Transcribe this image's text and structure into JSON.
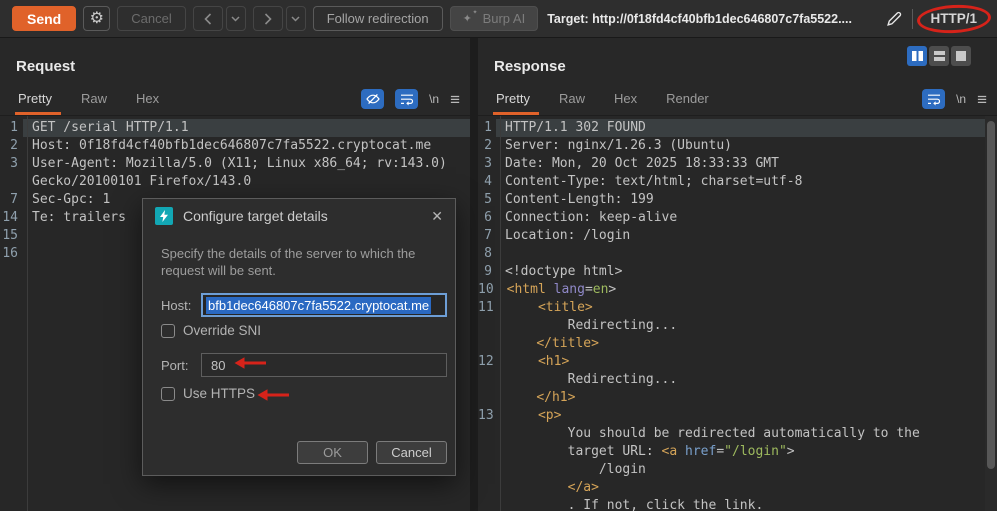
{
  "colors": {
    "accent_orange": "#e0622a",
    "accent_blue": "#2d6cc0",
    "annotation_red": "#d6231a",
    "syntax_tag": "#d5a458",
    "syntax_attribute": "#9089c9",
    "syntax_value": "#9eba5e"
  },
  "toolbar": {
    "send_label": "Send",
    "cancel_label": "Cancel",
    "follow_redirection_label": "Follow redirection",
    "burp_ai_label": "Burp AI",
    "target_text": "Target: http://0f18fd4cf40bfb1dec646807c7fa5522....",
    "http_version": "HTTP/1"
  },
  "request_panel": {
    "title": "Request",
    "tabs": [
      "Pretty",
      "Raw",
      "Hex"
    ],
    "newline_label": "\\n",
    "lines": [
      {
        "n": "1",
        "hl": true,
        "segs": [
          {
            "t": "GET /serial HTTP/1.1"
          }
        ]
      },
      {
        "n": "2",
        "segs": [
          {
            "t": "Host: 0f18fd4cf40bfb1dec646807c7fa5522.cryptocat.me"
          }
        ]
      },
      {
        "n": "3",
        "segs": [
          {
            "t": "User-Agent: Mozilla/5.0 (X11; Linux x86_64; rv:143.0)"
          }
        ]
      },
      {
        "n": "",
        "segs": [
          {
            "t": "Gecko/20100101 Firefox/143.0"
          }
        ]
      },
      {
        "n": "7",
        "segs": [
          {
            "t": "Sec-Gpc: 1"
          }
        ]
      },
      {
        "n": "14",
        "segs": [
          {
            "t": "Te: trailers"
          }
        ]
      },
      {
        "n": "15",
        "segs": []
      },
      {
        "n": "16",
        "segs": []
      }
    ]
  },
  "response_panel": {
    "title": "Response",
    "tabs": [
      "Pretty",
      "Raw",
      "Hex",
      "Render"
    ],
    "newline_label": "\\n",
    "lines": [
      {
        "n": "1",
        "hl": true,
        "segs": [
          {
            "t": "HTTP/1.1 302 FOUND"
          }
        ]
      },
      {
        "n": "2",
        "segs": [
          {
            "t": "Server: nginx/1.26.3 (Ubuntu)"
          }
        ]
      },
      {
        "n": "3",
        "segs": [
          {
            "t": "Date: Mon, 20 Oct 2025 18:33:33 GMT"
          }
        ]
      },
      {
        "n": "4",
        "segs": [
          {
            "t": "Content-Type: text/html; charset=utf-8"
          }
        ]
      },
      {
        "n": "5",
        "segs": [
          {
            "t": "Content-Length: 199"
          }
        ]
      },
      {
        "n": "6",
        "segs": [
          {
            "t": "Connection: keep-alive"
          }
        ]
      },
      {
        "n": "7",
        "segs": [
          {
            "t": "Location: /login"
          }
        ]
      },
      {
        "n": "8",
        "segs": []
      },
      {
        "n": "9",
        "segs": [
          {
            "t": "<!doctype html>"
          }
        ]
      },
      {
        "n": "10",
        "segs": [
          {
            "t": "<html",
            "c": "tag"
          },
          {
            "t": " "
          },
          {
            "t": "lang",
            "c": "attr"
          },
          {
            "t": "="
          },
          {
            "t": "en",
            "c": "val"
          },
          {
            "t": ">"
          }
        ]
      },
      {
        "n": "11",
        "segs": [
          {
            "t": "    "
          },
          {
            "t": "<title>",
            "c": "tag"
          }
        ]
      },
      {
        "n": "",
        "segs": [
          {
            "t": "        Redirecting..."
          }
        ]
      },
      {
        "n": "",
        "segs": [
          {
            "t": "    "
          },
          {
            "t": "</title>",
            "c": "tag"
          }
        ]
      },
      {
        "n": "12",
        "segs": [
          {
            "t": "    "
          },
          {
            "t": "<h1>",
            "c": "tag"
          }
        ]
      },
      {
        "n": "",
        "segs": [
          {
            "t": "        Redirecting..."
          }
        ]
      },
      {
        "n": "",
        "segs": [
          {
            "t": "    "
          },
          {
            "t": "</h1>",
            "c": "tag"
          }
        ]
      },
      {
        "n": "13",
        "segs": [
          {
            "t": "    "
          },
          {
            "t": "<p>",
            "c": "tag"
          }
        ]
      },
      {
        "n": "",
        "segs": [
          {
            "t": "        You should be redirected automatically to the"
          }
        ]
      },
      {
        "n": "",
        "segs": [
          {
            "t": "        target URL: "
          },
          {
            "t": "<a",
            "c": "tag"
          },
          {
            "t": " "
          },
          {
            "t": "href",
            "c": "attr2"
          },
          {
            "t": "="
          },
          {
            "t": "\"/login\"",
            "c": "val"
          },
          {
            "t": ">"
          }
        ]
      },
      {
        "n": "",
        "segs": [
          {
            "t": "            /login"
          }
        ]
      },
      {
        "n": "",
        "segs": [
          {
            "t": "        "
          },
          {
            "t": "</a>",
            "c": "tag"
          }
        ]
      },
      {
        "n": "",
        "segs": [
          {
            "t": "        . If not, click the link."
          }
        ]
      }
    ]
  },
  "dialog": {
    "title": "Configure target details",
    "description": "Specify the details of the server to which the request will be sent.",
    "host_label": "Host:",
    "host_value": "bfb1dec646807c7fa5522.cryptocat.me",
    "override_sni_label": "Override SNI",
    "port_label": "Port:",
    "port_value": "80",
    "use_https_label": "Use HTTPS",
    "ok_label": "OK",
    "cancel_label": "Cancel"
  },
  "annotations": {
    "circled_text": "HTTP/1",
    "arrow_targets": [
      "Port value",
      "Use HTTPS checkbox"
    ]
  }
}
